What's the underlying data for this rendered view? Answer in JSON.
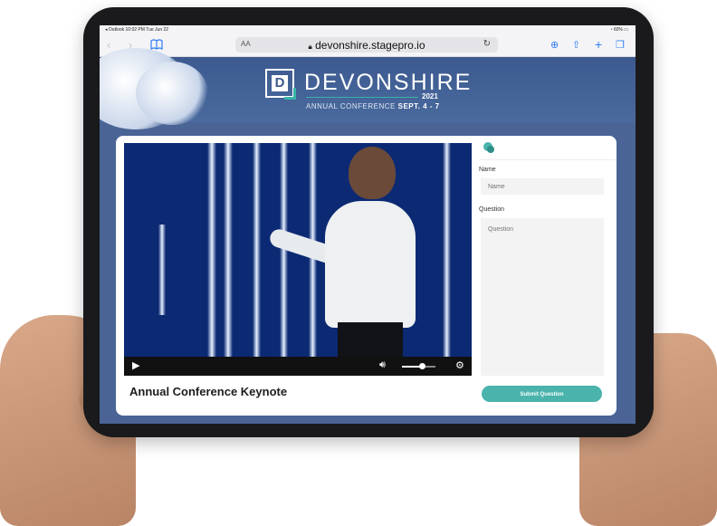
{
  "status_bar": {
    "left": "◂ Outlook  10:02 PM  Tue Jun 22",
    "battery": "60%"
  },
  "browser": {
    "text_size_label": "AA",
    "url": "devonshire.stagepro.io",
    "icons": [
      "back-icon",
      "forward-icon",
      "bookmarks-icon",
      "reload-icon",
      "download-icon",
      "share-icon",
      "new-tab-icon",
      "tabs-icon"
    ]
  },
  "hero": {
    "logo_letter": "D",
    "brand": "DEVONSHIRE",
    "year": "2021",
    "subtitle_prefix": "ANNUAL CONFERENCE",
    "subtitle_dates": "SEPT. 4 - 7"
  },
  "video": {
    "title": "Annual Conference Keynote",
    "volume_level": 0.6
  },
  "qa": {
    "name_label": "Name",
    "name_placeholder": "Name",
    "question_label": "Question",
    "question_placeholder": "Question",
    "submit_label": "Submit Question"
  },
  "colors": {
    "accent": "#49b3ac",
    "hero_bg": "#3c5a8f",
    "browser_blue": "#2f7cf6"
  }
}
